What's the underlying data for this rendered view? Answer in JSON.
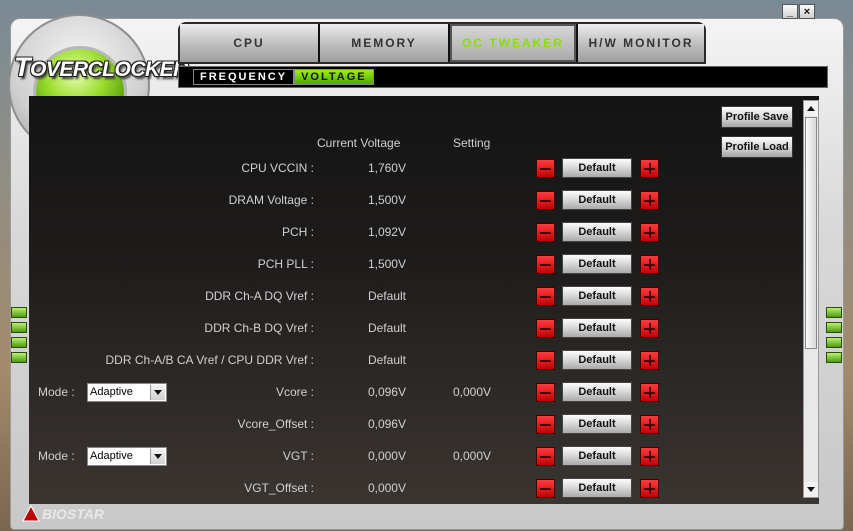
{
  "window": {
    "minimize": "_",
    "close": "×"
  },
  "logo": {
    "text": "OVERCLOCKER"
  },
  "tabs": [
    {
      "label": "CPU",
      "active": false
    },
    {
      "label": "MEMORY",
      "active": false
    },
    {
      "label": "OC TWEAKER",
      "active": true
    },
    {
      "label": "H/W MONITOR",
      "active": false
    }
  ],
  "subtabs": [
    {
      "label": "FREQUENCY",
      "active": false
    },
    {
      "label": "VOLTAGE",
      "active": true
    }
  ],
  "headers": {
    "current": "Current Voltage",
    "setting": "Setting"
  },
  "rows": [
    {
      "label": "CPU VCCIN :",
      "current": "1,760V",
      "setting": "",
      "button": "Default"
    },
    {
      "label": "DRAM Voltage :",
      "current": "1,500V",
      "setting": "",
      "button": "Default"
    },
    {
      "label": "PCH :",
      "current": "1,092V",
      "setting": "",
      "button": "Default"
    },
    {
      "label": "PCH PLL :",
      "current": "1,500V",
      "setting": "",
      "button": "Default"
    },
    {
      "label": "DDR Ch-A DQ Vref :",
      "current": "Default",
      "setting": "",
      "button": "Default"
    },
    {
      "label": "DDR Ch-B DQ Vref :",
      "current": "Default",
      "setting": "",
      "button": "Default"
    },
    {
      "label": "DDR Ch-A/B CA Vref / CPU DDR Vref :",
      "current": "Default",
      "setting": "",
      "button": "Default"
    },
    {
      "label": "Vcore :",
      "current": "0,096V",
      "setting": "0,000V",
      "button": "Default"
    },
    {
      "label": "Vcore_Offset :",
      "current": "0,096V",
      "setting": "",
      "button": "Default"
    },
    {
      "label": "VGT :",
      "current": "0,000V",
      "setting": "0,000V",
      "button": "Default"
    },
    {
      "label": "VGT_Offset :",
      "current": "0,000V",
      "setting": "",
      "button": "Default"
    }
  ],
  "modes": [
    {
      "label": "Mode :",
      "value": "Adaptive"
    },
    {
      "label": "Mode :",
      "value": "Adaptive"
    }
  ],
  "profile": {
    "save": "Profile Save",
    "load": "Profile Load"
  },
  "brand": {
    "name": "BIOSTAR"
  },
  "colors": {
    "accent": "#86e000",
    "minus_plus": "#e00000",
    "panel": "#1a1a1a"
  }
}
